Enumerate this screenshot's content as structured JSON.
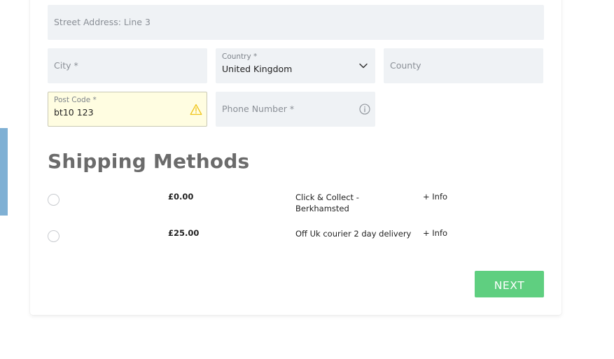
{
  "form": {
    "street_line3": {
      "placeholder": "Street Address: Line 3"
    },
    "city": {
      "placeholder": "City *"
    },
    "country": {
      "label": "Country  *",
      "value": "United Kingdom"
    },
    "county": {
      "placeholder": "County"
    },
    "postcode": {
      "label": "Post Code  *",
      "value": "bt10 123"
    },
    "phone": {
      "placeholder": "Phone Number *"
    }
  },
  "shipping": {
    "title": "Shipping Methods",
    "methods": [
      {
        "price": "£0.00",
        "description": "Click & Collect - Berkhamsted",
        "info": "+ Info"
      },
      {
        "price": "£25.00",
        "description": "Off Uk courier 2 day delivery",
        "info": "+ Info"
      }
    ]
  },
  "actions": {
    "next_label": "NEXT"
  },
  "colors": {
    "field_bg": "#eff2f5",
    "warning_bg": "#fffde1",
    "warning_icon": "#f0c419",
    "next_button": "#5fcf80",
    "side_tab": "#7fb0d4"
  }
}
